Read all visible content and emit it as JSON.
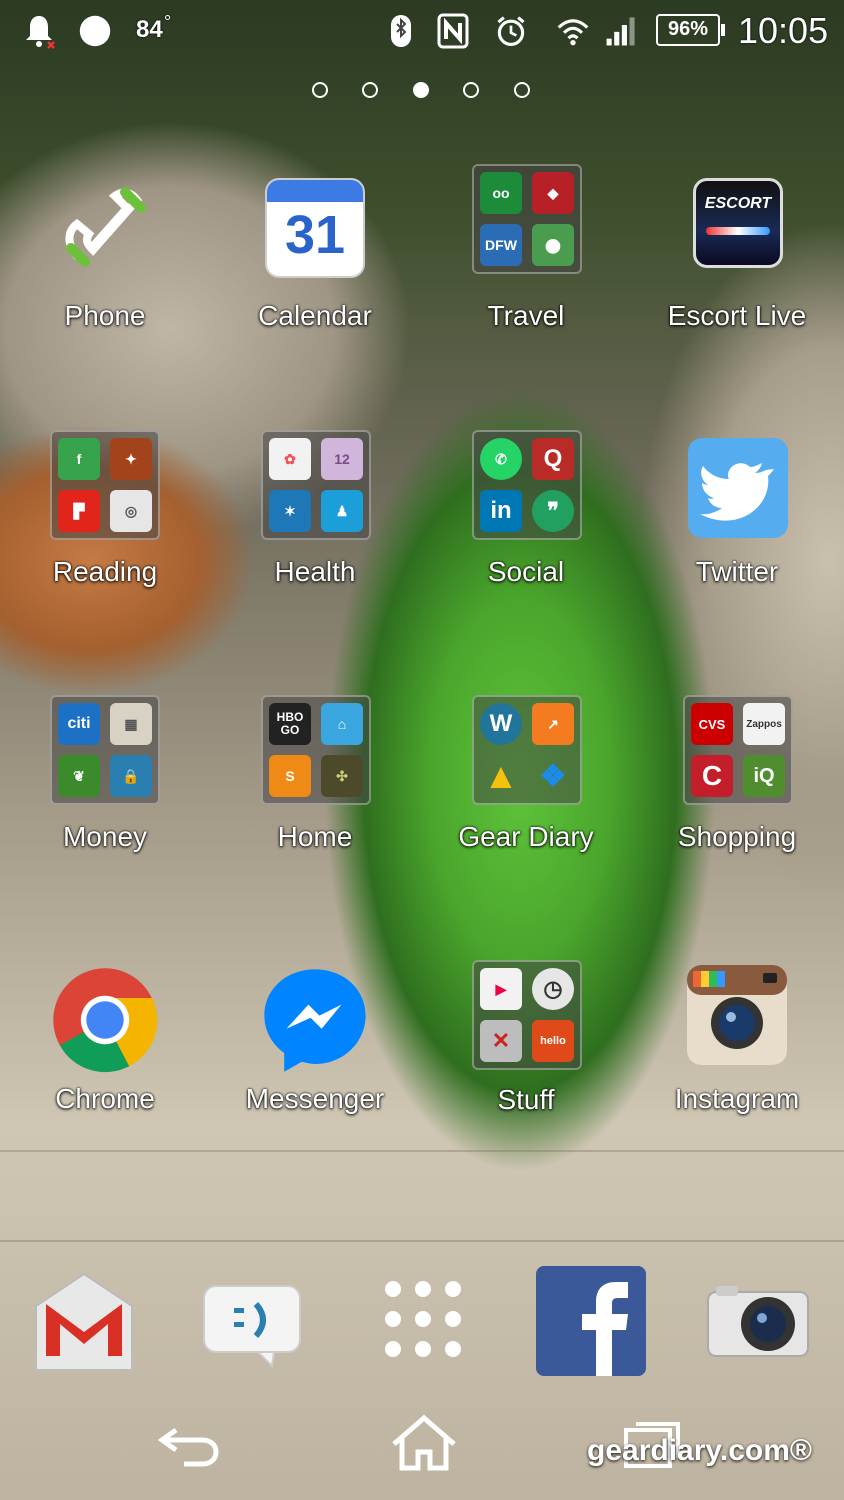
{
  "status_bar": {
    "temperature": "84",
    "temperature_unit": "°",
    "battery_percent": "96%",
    "time": "10:05",
    "icons": [
      "notification-bell-muted-icon",
      "weather-moon-icon",
      "bluetooth-icon",
      "nfc-icon",
      "alarm-clock-icon",
      "wifi-icon",
      "cell-signal-icon",
      "battery-icon"
    ]
  },
  "page_indicator": {
    "count": 5,
    "active_index": 2
  },
  "home_grid": [
    {
      "label": "Phone",
      "type": "app",
      "icon": "phone-handset-icon"
    },
    {
      "label": "Calendar",
      "type": "app",
      "icon": "calendar-icon",
      "icon_text": "31"
    },
    {
      "label": "Travel",
      "type": "folder",
      "mini": [
        {
          "text": "",
          "color": "#1c8c3a",
          "icon": "tripadvisor-owl-icon"
        },
        {
          "text": "",
          "color": "#b62026",
          "icon": "shield-icon"
        },
        {
          "text": "DFW",
          "color": "#2a6db5",
          "icon": "dfw-icon"
        },
        {
          "text": "",
          "color": "#4a9d4e",
          "icon": "maps-pin-icon"
        }
      ]
    },
    {
      "label": "Escort Live",
      "type": "app",
      "icon": "escort-radar-icon",
      "icon_text": "ESCORT"
    },
    {
      "label": "Reading",
      "type": "folder",
      "mini": [
        {
          "text": "",
          "color": "#37a34c",
          "icon": "feedly-icon"
        },
        {
          "text": "",
          "color": "#a3431c",
          "icon": "rooster-icon"
        },
        {
          "text": "",
          "color": "#e1251b",
          "icon": "flipboard-icon"
        },
        {
          "text": "",
          "color": "#e6e6e6",
          "icon": "rss-satellite-icon"
        }
      ]
    },
    {
      "label": "Health",
      "type": "folder",
      "mini": [
        {
          "text": "",
          "color": "#f2f2f2",
          "icon": "flower-icon"
        },
        {
          "text": "12",
          "color": "#cfb6da",
          "icon": "calendar-mini-icon"
        },
        {
          "text": "",
          "color": "#1e78b8",
          "icon": "fitness-figure-icon"
        },
        {
          "text": "",
          "color": "#1c9fd8",
          "icon": "runner-icon"
        }
      ]
    },
    {
      "label": "Social",
      "type": "folder",
      "mini": [
        {
          "text": "",
          "color": "#25d366",
          "icon": "whatsapp-icon"
        },
        {
          "text": "Q",
          "color": "#b92b27",
          "icon": "quora-icon"
        },
        {
          "text": "in",
          "color": "#0077b5",
          "icon": "linkedin-icon"
        },
        {
          "text": "",
          "color": "#21a060",
          "icon": "hangouts-icon"
        }
      ]
    },
    {
      "label": "Twitter",
      "type": "app",
      "icon": "twitter-bird-icon"
    },
    {
      "label": "Money",
      "type": "folder",
      "mini": [
        {
          "text": "citi",
          "color": "#1d71c4",
          "icon": "citi-icon"
        },
        {
          "text": "",
          "color": "#d8d2c4",
          "icon": "calculator-icon"
        },
        {
          "text": "",
          "color": "#3b8b2c",
          "icon": "leaf-icon"
        },
        {
          "text": "",
          "color": "#2a7fb0",
          "icon": "lock-icon"
        }
      ]
    },
    {
      "label": "Home",
      "type": "folder",
      "mini": [
        {
          "text": "HBO GO",
          "color": "#222222",
          "icon": "hbo-go-icon"
        },
        {
          "text": "",
          "color": "#3aa6e0",
          "icon": "house-icon"
        },
        {
          "text": "",
          "color": "#f08a16",
          "icon": "soundhound-icon"
        },
        {
          "text": "",
          "color": "#4d4a2c",
          "icon": "plant-icon"
        }
      ]
    },
    {
      "label": "Gear Diary",
      "type": "folder",
      "mini": [
        {
          "text": "",
          "color": "#21759b",
          "icon": "wordpress-icon"
        },
        {
          "text": "",
          "color": "#f47b20",
          "icon": "analytics-icon"
        },
        {
          "text": "",
          "color": "#f2f2f2",
          "icon": "drive-icon"
        },
        {
          "text": "",
          "color": "#1a8cf0",
          "icon": "dropbox-icon"
        }
      ]
    },
    {
      "label": "Shopping",
      "type": "folder",
      "mini": [
        {
          "text": "CVS",
          "color": "#cc0000",
          "icon": "cvs-icon"
        },
        {
          "text": "Zappos",
          "color": "#f2f2f2",
          "icon": "zappos-icon"
        },
        {
          "text": "C",
          "color": "#c41e2a",
          "icon": "cinemark-icon"
        },
        {
          "text": "iQ",
          "color": "#4f8d2e",
          "icon": "grocery-iq-icon"
        }
      ]
    },
    {
      "label": "Chrome",
      "type": "app",
      "icon": "chrome-icon"
    },
    {
      "label": "Messenger",
      "type": "app",
      "icon": "messenger-bolt-icon"
    },
    {
      "label": "Stuff",
      "type": "folder",
      "mini": [
        {
          "text": "",
          "color": "#f2f2f2",
          "icon": "play-store-icon"
        },
        {
          "text": "",
          "color": "#e6e6e6",
          "icon": "clock-icon"
        },
        {
          "text": "",
          "color": "#bdbdbd",
          "icon": "tools-icon"
        },
        {
          "text": "hello",
          "color": "#e04a1a",
          "icon": "hello-icon"
        }
      ]
    },
    {
      "label": "Instagram",
      "type": "app",
      "icon": "instagram-camera-icon"
    }
  ],
  "dock": [
    {
      "name": "gmail-icon"
    },
    {
      "name": "messaging-icon"
    },
    {
      "name": "app-drawer-icon"
    },
    {
      "name": "facebook-icon"
    },
    {
      "name": "camera-icon"
    }
  ],
  "nav": {
    "back": "back-icon",
    "home": "home-icon",
    "recents": "recents-icon"
  },
  "watermark": "geardiary.com®"
}
